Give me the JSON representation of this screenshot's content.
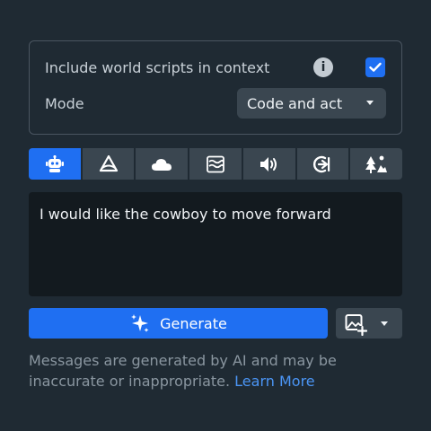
{
  "settings": {
    "include_scripts_label": "Include world scripts in context",
    "include_scripts_checked": true,
    "mode_label": "Mode",
    "mode_value": "Code and act"
  },
  "tabs": [
    {
      "icon": "robot-icon",
      "active": true
    },
    {
      "icon": "cone-icon",
      "active": false
    },
    {
      "icon": "cloud-icon",
      "active": false
    },
    {
      "icon": "water-waves-icon",
      "active": false
    },
    {
      "icon": "speaker-icon",
      "active": false
    },
    {
      "icon": "circle-arrow-icon",
      "active": false
    },
    {
      "icon": "trees-icon",
      "active": false
    }
  ],
  "prompt": {
    "text": "I would like the cowboy to move forward"
  },
  "actions": {
    "generate_label": "Generate"
  },
  "disclaimer": {
    "text": "Messages are generated by AI and may be inaccurate or inappropriate.",
    "link": "Learn More"
  },
  "colors": {
    "accent": "#1f6ff2",
    "background": "#1f2a33",
    "link": "#4b95f5"
  }
}
